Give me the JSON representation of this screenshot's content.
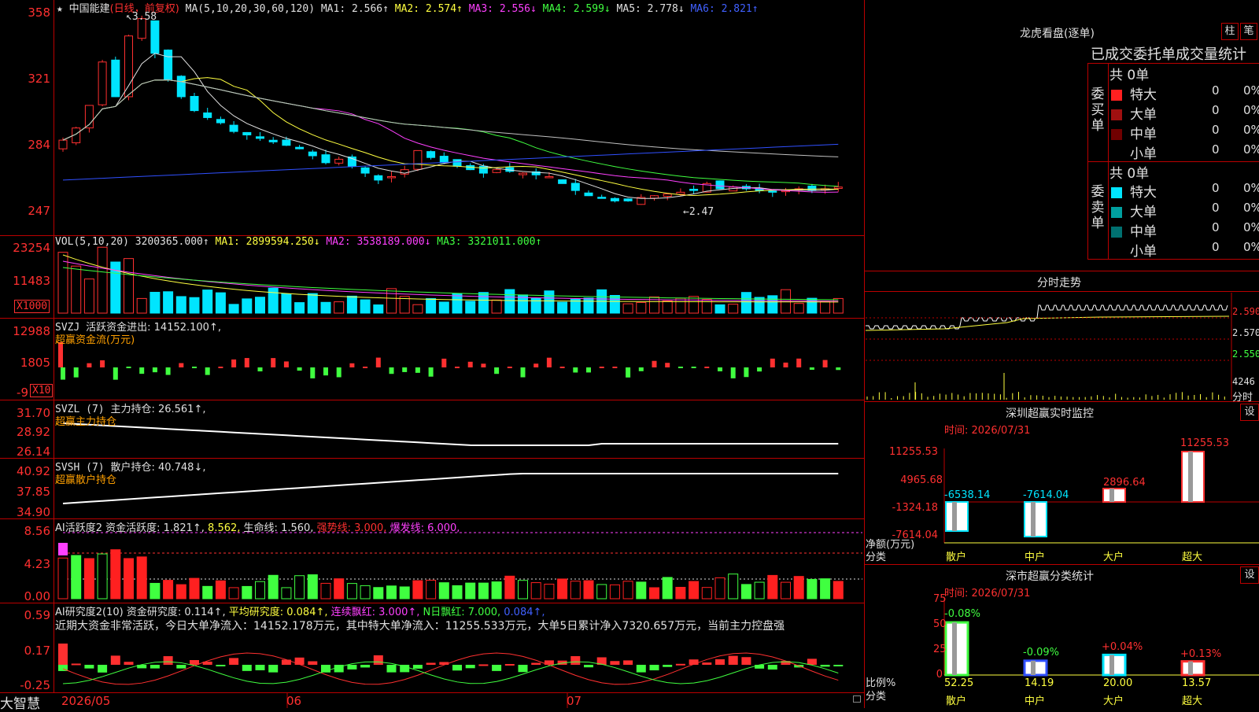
{
  "stock": {
    "name": "中国能建",
    "star": "★"
  },
  "kline": {
    "header_period": "(日线，前复权)",
    "header_ma": "MA(5,10,20,30,60,120)",
    "ma1": "MA1: 2.566↑",
    "ma2": "MA2: 2.574↑",
    "ma3": "MA3: 2.556↓",
    "ma4": "MA4: 2.599↓",
    "ma5": "MA5: 2.778↓",
    "ma6": "MA6: 2.821↑",
    "yticks": [
      "358",
      "321",
      "284",
      "247"
    ],
    "high_label": "3.58",
    "low_label": "2.47",
    "colors": {
      "up": "#ff3030",
      "down": "#00e5ff",
      "ma1": "#e0e0e0",
      "ma2": "#ffff40",
      "ma3": "#ff40ff",
      "ma4": "#40ff40",
      "ma5": "#c0c0c0",
      "ma6": "#3050ff"
    }
  },
  "vol": {
    "name": "VOL(5,10,20)",
    "value": "3200365.000↑",
    "ma1": "MA1: 2899594.250↓",
    "ma2": "MA2: 3538189.000↓",
    "ma3": "MA3: 3321011.000↑",
    "yticks": [
      "23254",
      "11483"
    ],
    "unit": "X1000"
  },
  "svzj": {
    "name": "SVZJ",
    "label": "活跃资金进出: 14152.100↑,",
    "sub": "超赢资金流(万元)",
    "yticks": [
      "12988",
      "1805",
      "-9"
    ],
    "unit": "X10"
  },
  "svzl": {
    "name": "SVZL (7)",
    "label": "主力持仓: 26.561↑,",
    "sub": "超赢主力持仓",
    "yticks": [
      "31.70",
      "28.92",
      "26.14"
    ]
  },
  "svsh": {
    "name": "SVSH (7)",
    "label": "散户持仓: 40.748↓,",
    "sub": "超赢散户持仓",
    "yticks": [
      "40.92",
      "37.85",
      "34.90"
    ]
  },
  "ai1": {
    "name": "AI活跃度2",
    "a": "资金活跃度: 1.821↑,",
    "b": "8.562,",
    "c": "生命线: 1.560,",
    "d": "强势线: 3.000,",
    "e": "爆发线: 6.000,",
    "yticks": [
      "8.56",
      "4.23",
      "0.00"
    ]
  },
  "ai2": {
    "name": "AI研究度2(10)",
    "a": "资金研究度: 0.114↑,",
    "b": "平均研究度: 0.084↑,",
    "c": "连续飘红: 3.000↑,",
    "d": "N日飘红: 7.000,",
    "e": "0.084↑,",
    "comment": "近期大资金非常活跃，今日大单净流入：14152.178万元，其中特大单净流入：11255.533万元，大单5日累计净入7320.657万元，当前主力控盘强",
    "yticks": [
      "0.59",
      "0.17",
      "-0.25"
    ]
  },
  "footer": {
    "brand": "大智慧",
    "d1": "2026/05",
    "d2": "06",
    "d3": "07"
  },
  "right": {
    "title": "龙虎看盘(逐单)",
    "btn_bar": "柱",
    "btn_pen": "笔",
    "order_title": "已成交委托单成交量统计",
    "buy_label": "委买单",
    "sell_label": "委卖单",
    "buy_total": "共 0单",
    "sell_total": "共 0单",
    "buy_rows": [
      {
        "name": "特大",
        "count": "0",
        "pct": "0%",
        "color": "#ff2020"
      },
      {
        "name": "大单",
        "count": "0",
        "pct": "0%",
        "color": "#a01010"
      },
      {
        "name": "中单",
        "count": "0",
        "pct": "0%",
        "color": "#700000"
      },
      {
        "name": "小单",
        "count": "0",
        "pct": "0%",
        "color": "#000000"
      }
    ],
    "sell_rows": [
      {
        "name": "特大",
        "count": "0",
        "pct": "0%",
        "color": "#00e5ff"
      },
      {
        "name": "大单",
        "count": "0",
        "pct": "0%",
        "color": "#00a0a0"
      },
      {
        "name": "中单",
        "count": "0",
        "pct": "0%",
        "color": "#007070"
      },
      {
        "name": "小单",
        "count": "0",
        "pct": "0%",
        "color": "#000000"
      }
    ],
    "intraday_title": "分时走势",
    "intraday_ticks": [
      "2.590",
      "2.570",
      "2.550"
    ],
    "intraday_vol": "4246",
    "intraday_btn": "分时",
    "monitor_title": "深圳超赢实时监控",
    "monitor_time": "时间: 2026/07/31",
    "monitor_btn": "设",
    "monitor_yticks": [
      "11255.53",
      "4965.68",
      "-1324.18",
      "-7614.04"
    ],
    "monitor_ylabel": "净额(万元)",
    "monitor_xlabel": "分类",
    "monitor_cats": [
      "散户",
      "中户",
      "大户",
      "超大"
    ],
    "monitor_vals": [
      "-6538.14",
      "-7614.04",
      "2896.64",
      "11255.53"
    ],
    "class_title": "深市超赢分类统计",
    "class_time": "时间: 2026/07/31",
    "class_btn": "设",
    "class_yticks": [
      "75",
      "50",
      "25",
      "0"
    ],
    "class_ylabel": "比例%",
    "class_xlabel": "分类",
    "class_cats": [
      "散户",
      "中户",
      "大户",
      "超大"
    ],
    "class_vals": [
      "52.25",
      "14.19",
      "20.00",
      "13.57"
    ],
    "class_changes": [
      "-0.08%",
      "-0.09%",
      "+0.04%",
      "+0.13%"
    ]
  }
}
